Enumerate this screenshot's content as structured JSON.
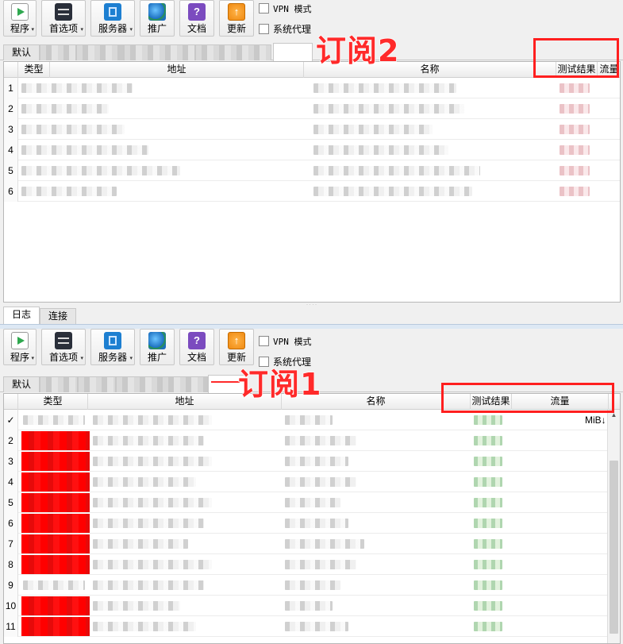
{
  "toolbar": {
    "program": "程序",
    "preferences": "首选项",
    "servers": "服务器",
    "promote": "推广",
    "docs": "文档",
    "update": "更新",
    "vpn_label": "VPN 模式",
    "proxy_label": "系统代理"
  },
  "top": {
    "tabs": [
      "默认"
    ],
    "annotation": "订阅2",
    "columns": [
      "类型",
      "地址",
      "名称",
      "测试结果",
      "流量"
    ],
    "row_numbers": [
      "1",
      "2",
      "3",
      "4",
      "5",
      "6"
    ]
  },
  "log_tabs": [
    "日志",
    "连接"
  ],
  "bottom": {
    "tabs": [
      "默认"
    ],
    "annotation": "订阅1",
    "columns": [
      "类型",
      "地址",
      "名称",
      "测试结果",
      "流量"
    ],
    "row_numbers": [
      "✓",
      "2",
      "3",
      "4",
      "5",
      "6",
      "7",
      "8",
      "9",
      "10",
      "11"
    ],
    "traffic_first": "MiB↓"
  },
  "colors": {
    "annotation": "#ff2a2a",
    "accent_red": "#ff0000",
    "selection": "#dde8f4"
  }
}
